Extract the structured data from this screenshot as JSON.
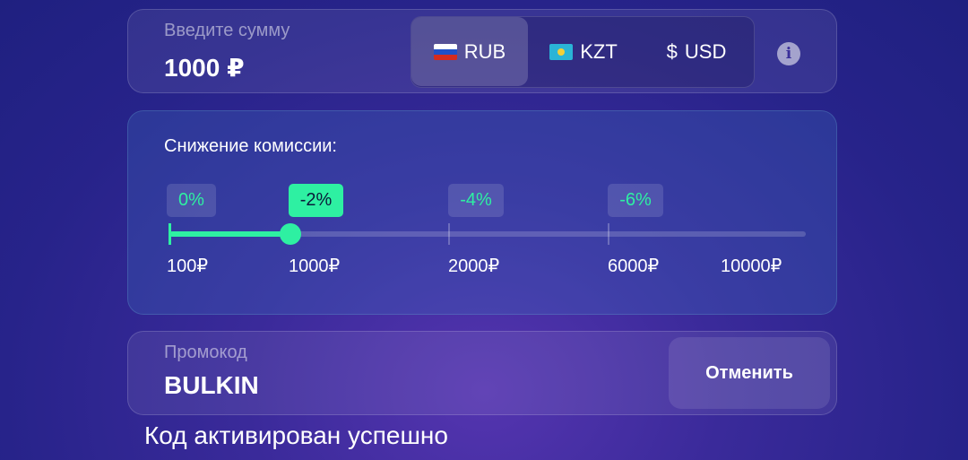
{
  "amount": {
    "label": "Введите сумму",
    "value": "1000 ₽",
    "currencies": [
      {
        "label": "RUB",
        "icon": "flag-russia-icon",
        "selected": true
      },
      {
        "label": "KZT",
        "icon": "flag-kazakhstan-icon",
        "selected": false
      },
      {
        "label": "USD",
        "icon": "dollar-icon",
        "selected": false
      }
    ],
    "dollar_glyph": "$",
    "info_icon": "i"
  },
  "commission": {
    "title": "Снижение комиссии:",
    "discounts": [
      "0%",
      "-2%",
      "-4%",
      "-6%"
    ],
    "active_discount": "-2%",
    "steps": [
      "100₽",
      "1000₽",
      "2000₽",
      "6000₽",
      "10000₽"
    ],
    "selected_step": "1000₽"
  },
  "promo": {
    "label": "Промокод",
    "value": "BULKIN",
    "cancel_label": "Отменить"
  },
  "status": "Код активирован успешно",
  "colors": {
    "accent": "#2ef0a2",
    "background": "#2a2590"
  }
}
